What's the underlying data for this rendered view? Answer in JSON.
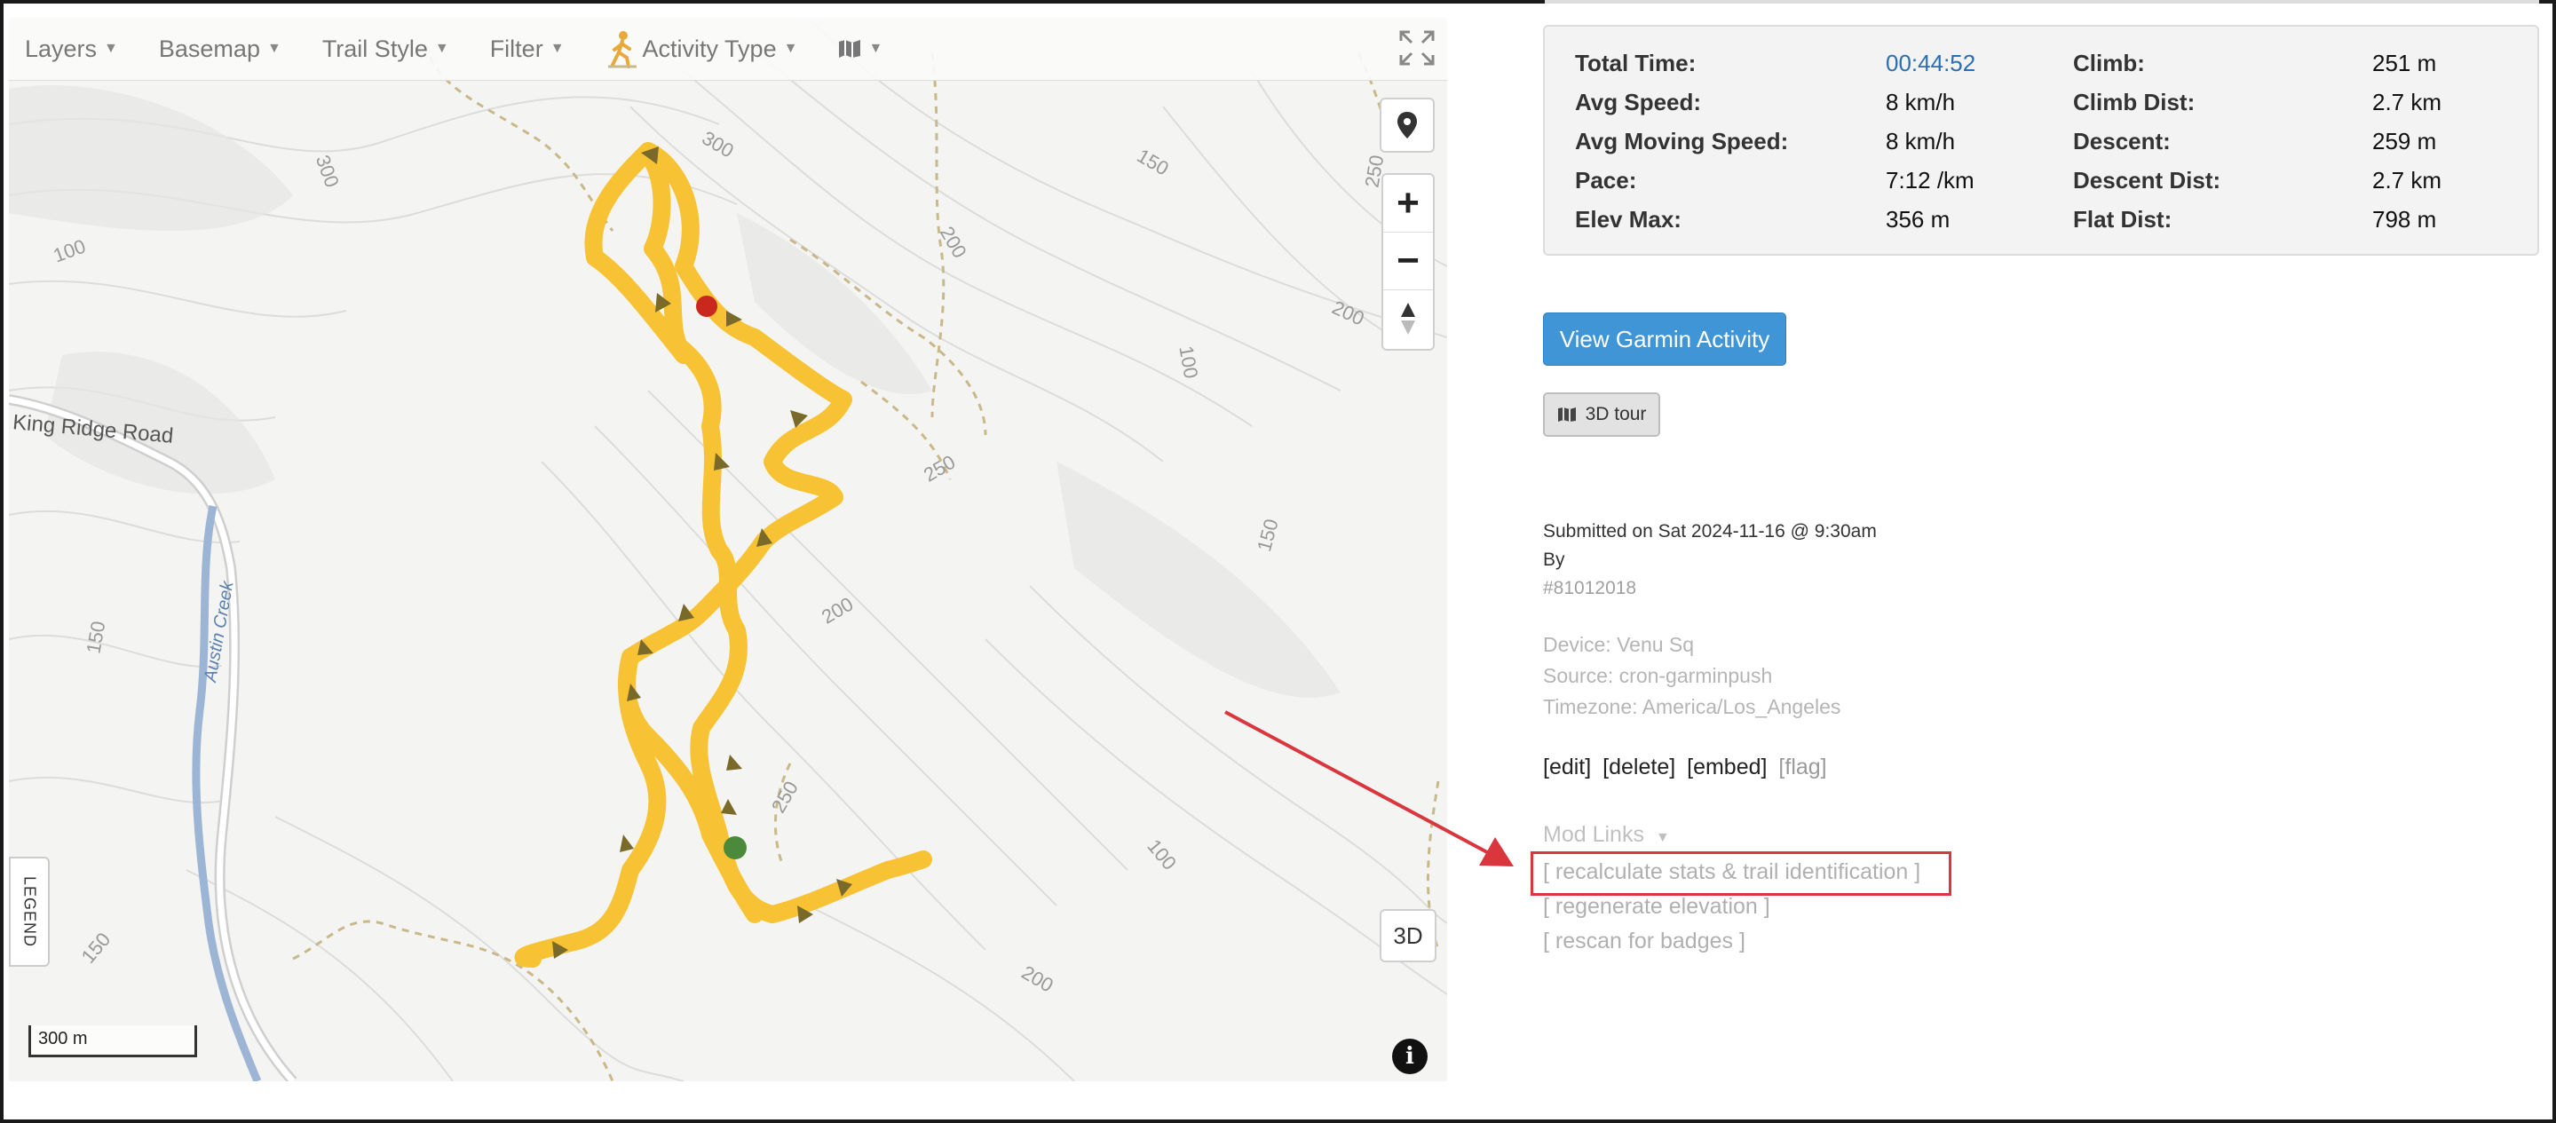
{
  "map": {
    "toolbar": {
      "layers": "Layers",
      "basemap": "Basemap",
      "trail_style": "Trail Style",
      "filter": "Filter",
      "activity_type": "Activity Type"
    },
    "legend": "LEGEND",
    "btn_3d": "3D",
    "scale": "300 m",
    "road": "King Ridge Road",
    "creek": "Austin Creek",
    "contours": [
      "300",
      "300",
      "100",
      "150",
      "250",
      "200",
      "200",
      "100",
      "250",
      "150",
      "200",
      "250",
      "100",
      "150",
      "150",
      "200"
    ]
  },
  "stats": {
    "total_time_label": "Total Time:",
    "total_time": "00:44:52",
    "avg_speed_label": "Avg Speed:",
    "avg_speed": "8 km/h",
    "avg_moving_label": "Avg Moving Speed:",
    "avg_moving": "8 km/h",
    "pace_label": "Pace:",
    "pace": "7:12 /km",
    "elev_max_label": "Elev Max:",
    "elev_max": "356 m",
    "climb_label": "Climb:",
    "climb": "251 m",
    "climb_dist_label": "Climb Dist:",
    "climb_dist": "2.7 km",
    "descent_label": "Descent:",
    "descent": "259 m",
    "descent_dist_label": "Descent Dist:",
    "descent_dist": "2.7 km",
    "flat_dist_label": "Flat Dist:",
    "flat_dist": "798 m"
  },
  "buttons": {
    "garmin": "View Garmin Activity",
    "tour": "3D tour"
  },
  "meta": {
    "submitted": "Submitted on Sat 2024-11-16 @ 9:30am",
    "by": "By",
    "id": "#81012018",
    "device": "Device: Venu Sq",
    "source": "Source: cron-garminpush",
    "timezone": "Timezone: America/Los_Angeles"
  },
  "actions": {
    "edit": "[edit]",
    "delete": "[delete]",
    "embed": "[embed]",
    "flag": "[flag]"
  },
  "mod": {
    "title": "Mod Links",
    "recalc": "[ recalculate stats & trail identification ]",
    "regen": "[ regenerate elevation ]",
    "rescan": "[ rescan for badges ]"
  },
  "colors": {
    "trail": "#f7c234",
    "start": "#4a8a3a",
    "end": "#c9281e",
    "highlight": "#d9363e",
    "button": "#3f95d6"
  }
}
